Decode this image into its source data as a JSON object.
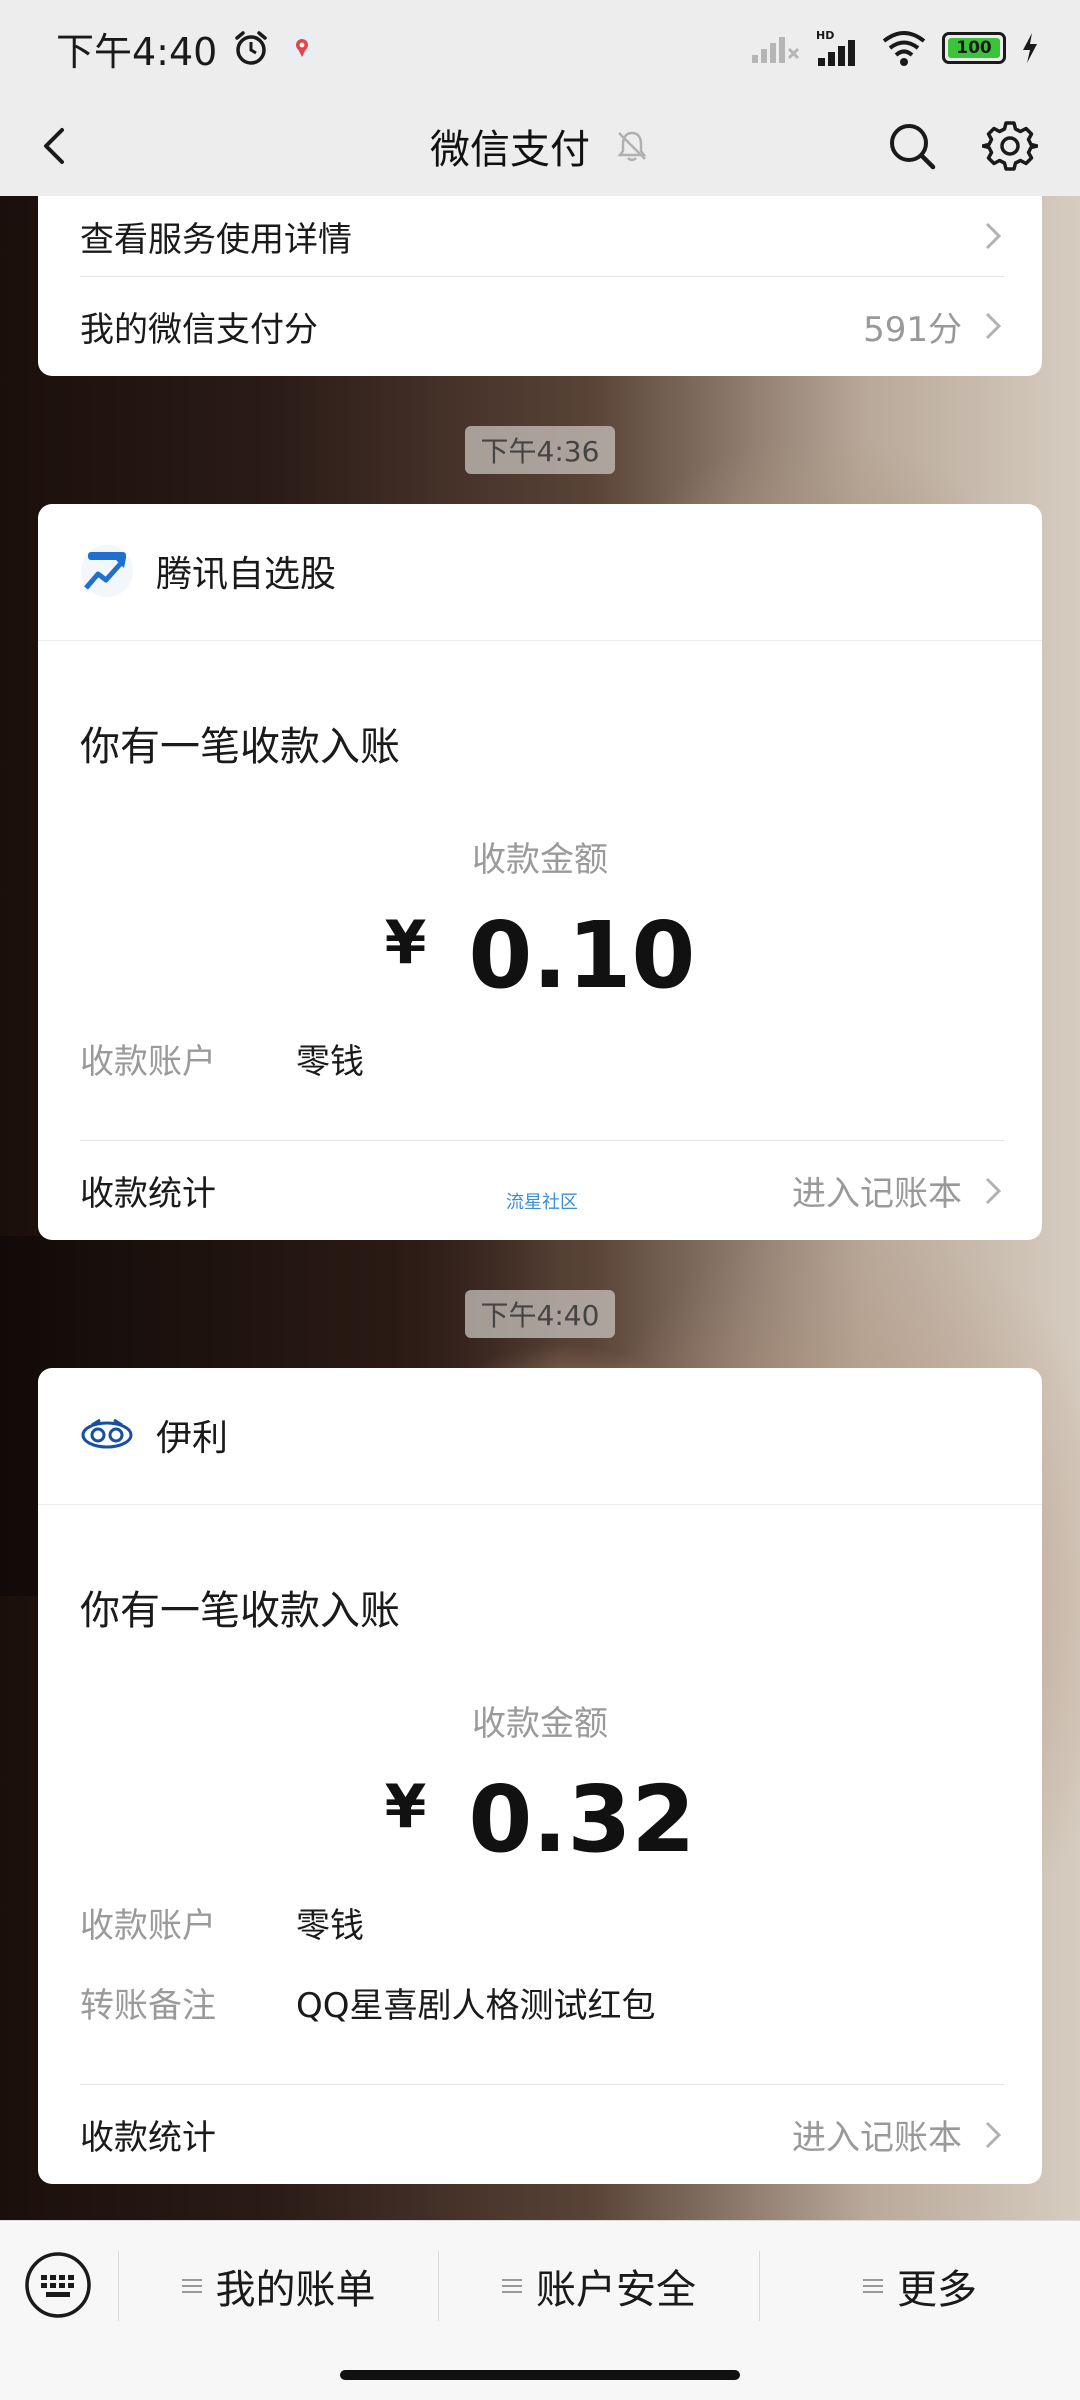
{
  "status_bar": {
    "time": "下午4:40",
    "battery": "100"
  },
  "header": {
    "title": "微信支付"
  },
  "service_card": {
    "view_details": "查看服务使用详情",
    "payscore_label": "我的微信支付分",
    "payscore_value": "591分"
  },
  "messages": [
    {
      "time": "下午4:36",
      "merchant": "腾讯自选股",
      "title": "你有一笔收款入账",
      "amount_label": "收款金额",
      "currency": "¥",
      "amount": "0.10",
      "account_key": "收款账户",
      "account_value": "零钱",
      "stats_label": "收款统计",
      "stats_link": "进入记账本",
      "watermark": "流星社区"
    },
    {
      "time": "下午4:40",
      "merchant": "伊利",
      "title": "你有一笔收款入账",
      "amount_label": "收款金额",
      "currency": "¥",
      "amount": "0.32",
      "account_key": "收款账户",
      "account_value": "零钱",
      "note_key": "转账备注",
      "note_value": "QQ星喜剧人格测试红包",
      "stats_label": "收款统计",
      "stats_link": "进入记账本"
    }
  ],
  "bottom_menu": {
    "items": [
      "我的账单",
      "账户安全",
      "更多"
    ]
  }
}
